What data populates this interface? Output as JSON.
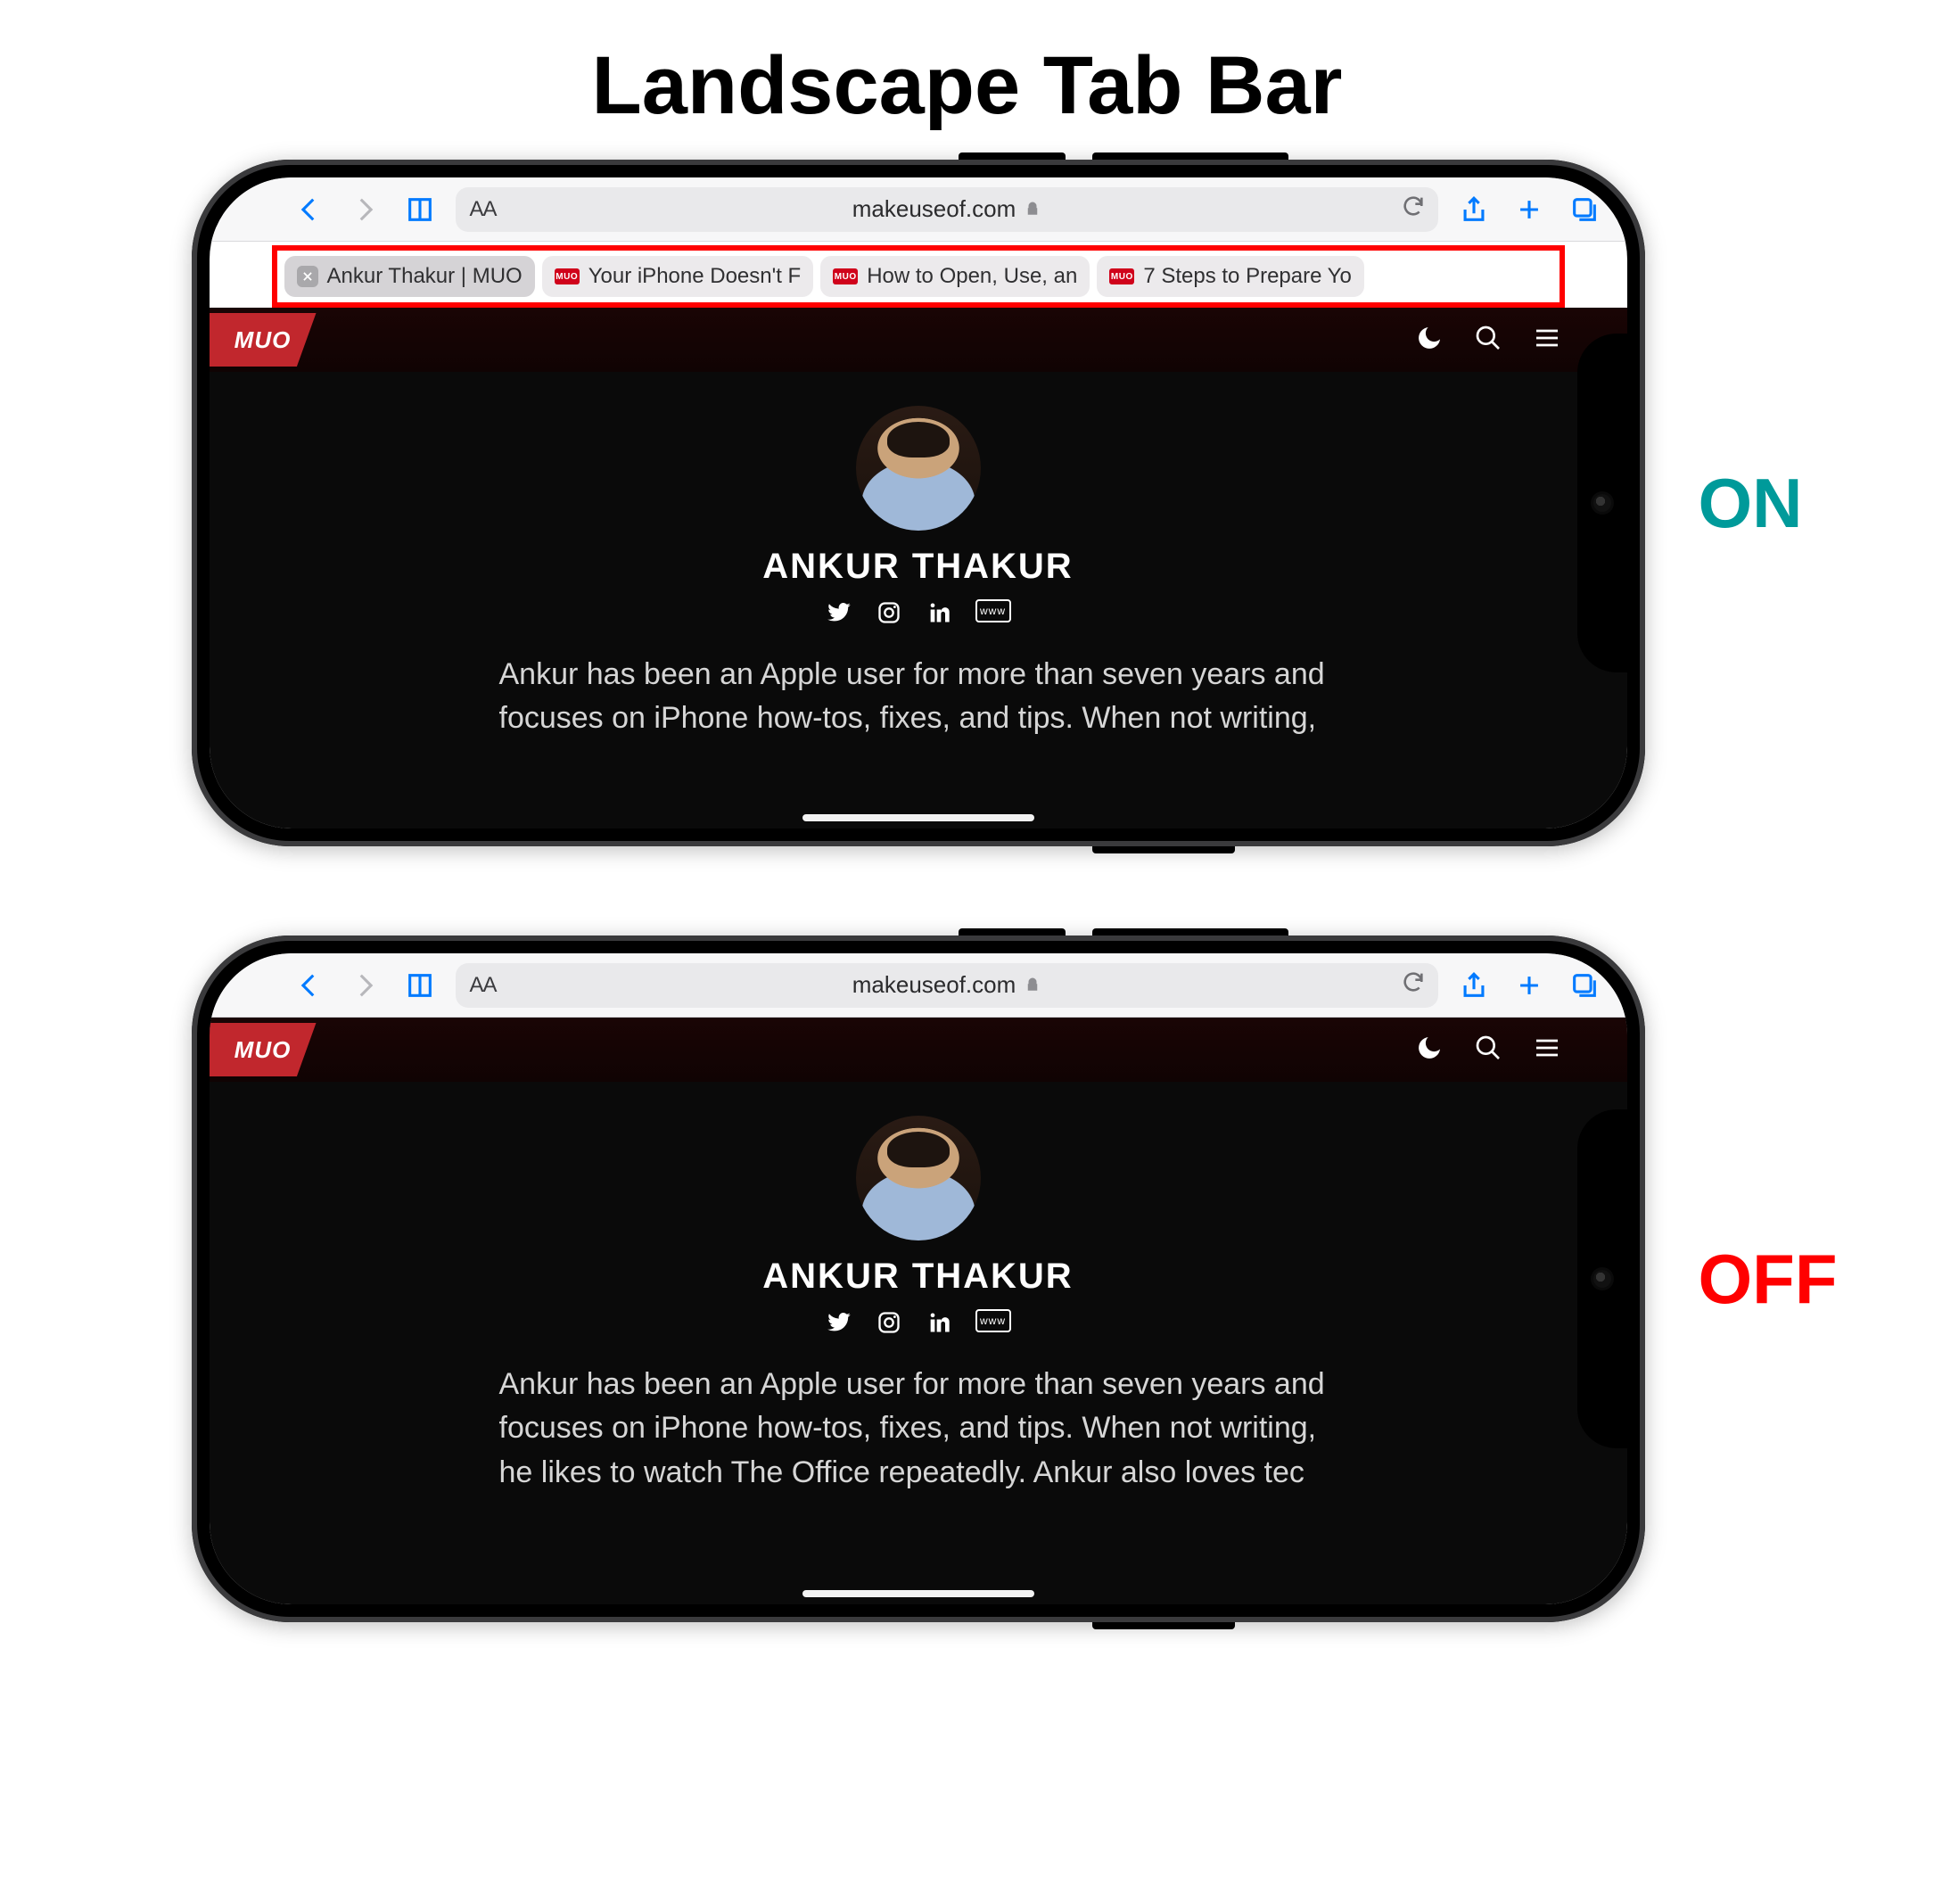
{
  "page_title": "Landscape Tab Bar",
  "labels": {
    "on": "ON",
    "off": "OFF"
  },
  "colors": {
    "on": "#009a9a",
    "off": "#ff0000",
    "highlight_box": "#ff0000",
    "ios_tint": "#007aff",
    "muo_red": "#c1272d"
  },
  "safari": {
    "address": "makeuseof.com",
    "aa_label": "AA",
    "tabs": [
      {
        "label": "Ankur Thakur | MUO",
        "active": true,
        "closeable": true,
        "favicon": "none"
      },
      {
        "label": "Your iPhone Doesn't F",
        "active": false,
        "closeable": false,
        "favicon": "muo"
      },
      {
        "label": "How to Open, Use, an",
        "active": false,
        "closeable": false,
        "favicon": "muo"
      },
      {
        "label": "7 Steps to Prepare Yo",
        "active": false,
        "closeable": false,
        "favicon": "muo"
      }
    ]
  },
  "webpage": {
    "site_logo_text": "MUO",
    "author_name": "ANKUR THAKUR",
    "www_label": "www",
    "bio_on": "Ankur has been an Apple user for more than seven years and focuses on iPhone how-tos, fixes, and tips. When not writing,",
    "bio_off": "Ankur has been an Apple user for more than seven years and focuses on iPhone how-tos, fixes, and tips. When not writing, he likes to watch The Office repeatedly. Ankur also loves tec"
  }
}
